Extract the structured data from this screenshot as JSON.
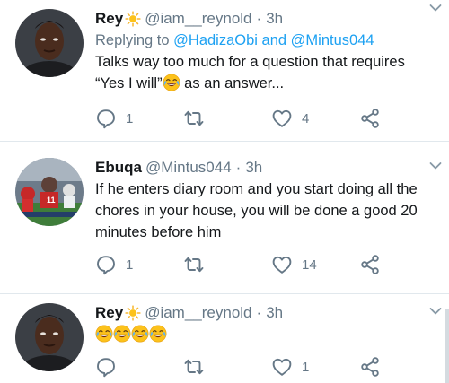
{
  "tweets": [
    {
      "name": "Rey",
      "name_emoji": "sun",
      "handle": "@iam__reynold",
      "time": "3h",
      "replying_prefix": "Replying to",
      "replying_to_1": "@HadizaObi",
      "replying_and": "and",
      "replying_to_2": "@Mintus044",
      "text_line1": "Talks way too much for a question  that requires",
      "text_line2_a": "“Yes I will”",
      "text_line2_b": " as an answer...",
      "reply_count": "1",
      "retweet_count": "",
      "like_count": "4"
    },
    {
      "name": "Ebuqa",
      "handle": "@Mintus044",
      "time": "3h",
      "text": "If he enters diary room and you start doing all the chores in your house, you will be done a good 20 minutes before him",
      "reply_count": "1",
      "retweet_count": "",
      "like_count": "14"
    },
    {
      "name": "Rey",
      "name_emoji": "sun",
      "handle": "@iam__reynold",
      "time": "3h",
      "text_emojis": "laughing-crying x4",
      "reply_count": "",
      "retweet_count": "",
      "like_count": "1"
    }
  ],
  "separator": "·",
  "icons": [
    "chevron-down-icon",
    "reply-icon",
    "retweet-icon",
    "like-icon",
    "share-icon",
    "sun-emoji",
    "laughing-crying-emoji"
  ],
  "colors": {
    "link": "#1da1f2",
    "muted": "#657786",
    "text": "#14171a",
    "divider": "#e1e8ed"
  }
}
